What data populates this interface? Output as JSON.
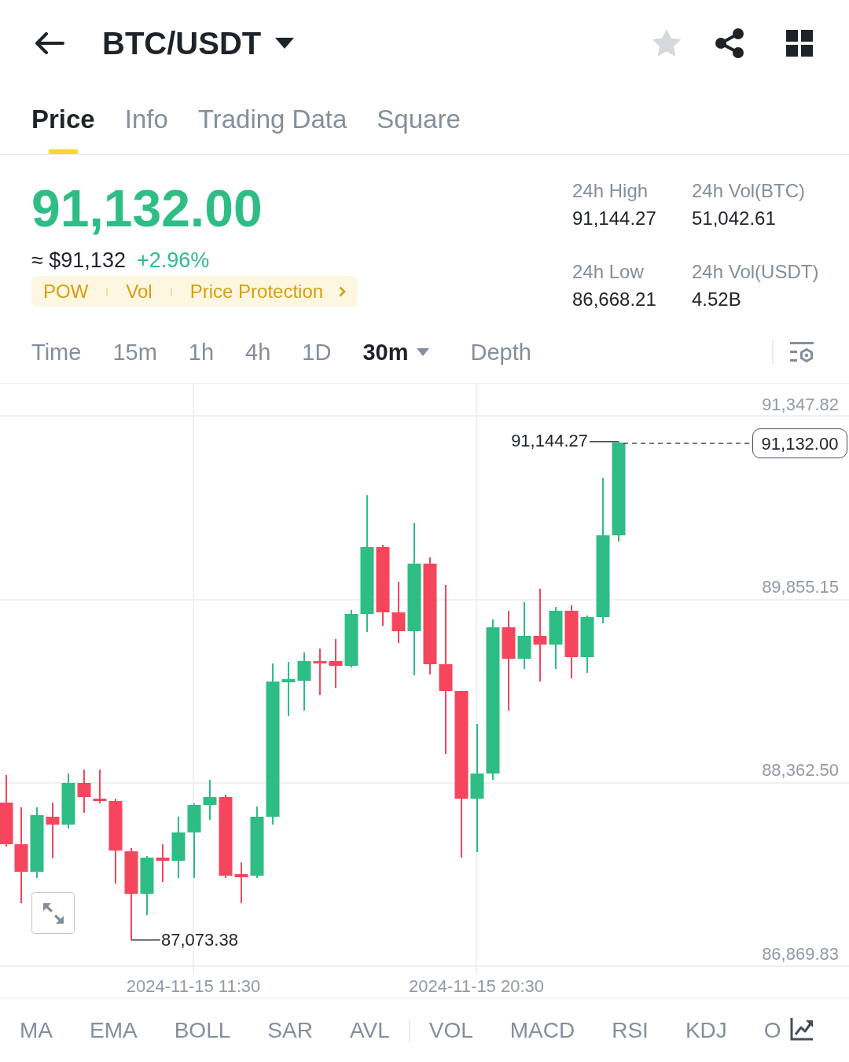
{
  "header": {
    "title": "BTC/USDT"
  },
  "tabs": [
    {
      "label": "Price",
      "selected": true
    },
    {
      "label": "Info",
      "selected": false
    },
    {
      "label": "Trading Data",
      "selected": false
    },
    {
      "label": "Square",
      "selected": false
    }
  ],
  "ticker": {
    "price": "91,132.00",
    "approx_price": "≈ $91,132",
    "change": "+2.96%",
    "tags": [
      "POW",
      "Vol"
    ],
    "protection_link": "Price Protection"
  },
  "stats": [
    {
      "label": "24h High",
      "value": "91,144.27"
    },
    {
      "label": "24h Vol(BTC)",
      "value": "51,042.61"
    },
    {
      "label": "24h Low",
      "value": "86,668.21"
    },
    {
      "label": "24h Vol(USDT)",
      "value": "4.52B"
    }
  ],
  "intervals": [
    {
      "label": "Time",
      "kind": "option",
      "selected": false
    },
    {
      "label": "15m",
      "kind": "option",
      "selected": false
    },
    {
      "label": "1h",
      "kind": "option",
      "selected": false
    },
    {
      "label": "4h",
      "kind": "option",
      "selected": false
    },
    {
      "label": "1D",
      "kind": "option",
      "selected": false
    },
    {
      "label": "30m",
      "kind": "dropdown",
      "selected": true
    },
    {
      "label": "Depth",
      "kind": "option",
      "selected": false
    }
  ],
  "chart": {
    "y_axis_labels": [
      "91,347.82",
      "89,855.15",
      "88,362.50",
      "86,869.83"
    ],
    "x_axis_labels": [
      "2024-11-15 11:30",
      "2024-11-15 20:30"
    ],
    "high_label": "91,144.27",
    "low_label": "87,073.38",
    "last_price": "91,132.00"
  },
  "indicators": {
    "main": [
      "MA",
      "EMA",
      "BOLL",
      "SAR",
      "AVL"
    ],
    "sub": [
      "VOL",
      "MACD",
      "RSI",
      "KDJ",
      "O"
    ]
  }
}
